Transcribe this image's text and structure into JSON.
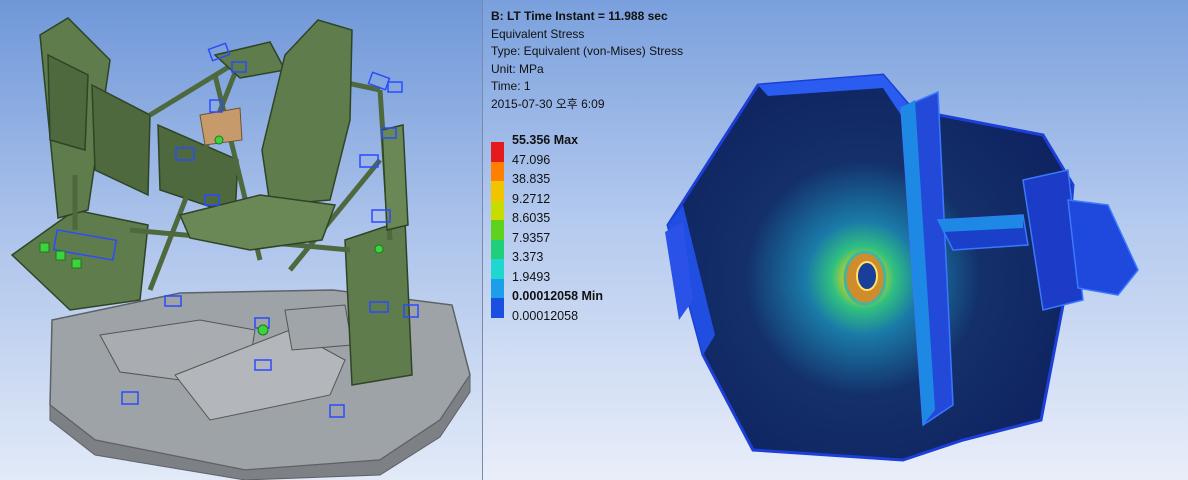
{
  "result": {
    "title": "B: LT Time Instant = 11.988 sec",
    "lines": [
      "Equivalent Stress",
      "Type: Equivalent (von-Mises) Stress",
      "Unit: MPa",
      "Time: 1",
      "2015-07-30 오후 6:09"
    ]
  },
  "legend": {
    "items": [
      {
        "label": "55.356 Max",
        "color": "#e41a1c",
        "bold": true
      },
      {
        "label": "47.096",
        "color": "#ff7f00",
        "bold": false
      },
      {
        "label": "38.835",
        "color": "#f2c400",
        "bold": false
      },
      {
        "label": "9.2712",
        "color": "#c8dc00",
        "bold": false
      },
      {
        "label": "8.6035",
        "color": "#5fd11f",
        "bold": false
      },
      {
        "label": "7.9357",
        "color": "#1fcf7a",
        "bold": false
      },
      {
        "label": "3.373",
        "color": "#1fd6d0",
        "bold": false
      },
      {
        "label": "1.9493",
        "color": "#1c9ee8",
        "bold": false
      },
      {
        "label": "0.00012058 Min",
        "color": "#1a4fe0",
        "bold": true
      },
      {
        "label": "0.00012058",
        "color": "#1230c8",
        "bold": false
      }
    ]
  }
}
